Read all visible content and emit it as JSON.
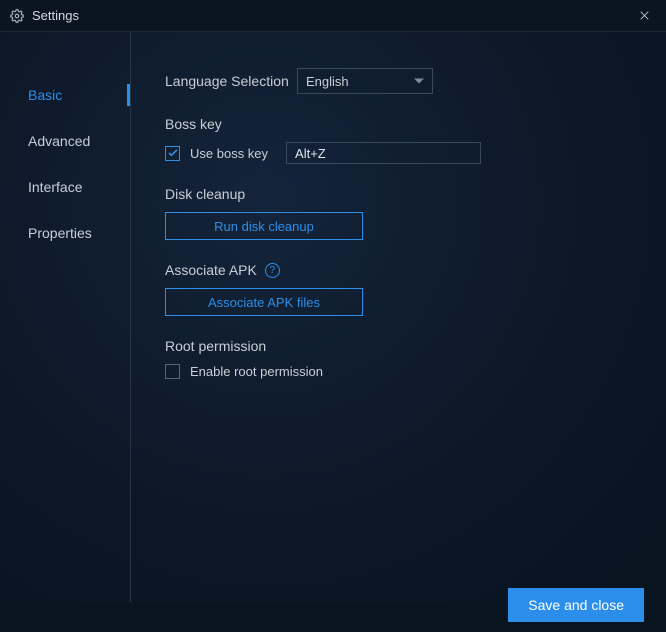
{
  "window": {
    "title": "Settings"
  },
  "sidebar": {
    "tabs": [
      {
        "label": "Basic",
        "active": true
      },
      {
        "label": "Advanced",
        "active": false
      },
      {
        "label": "Interface",
        "active": false
      },
      {
        "label": "Properties",
        "active": false
      }
    ]
  },
  "main": {
    "language": {
      "label": "Language Selection",
      "value": "English"
    },
    "bosskey": {
      "title": "Boss key",
      "checkbox_label": "Use boss key",
      "checked": true,
      "hotkey": "Alt+Z"
    },
    "cleanup": {
      "title": "Disk cleanup",
      "button": "Run disk cleanup"
    },
    "associate": {
      "title": "Associate APK",
      "help": "?",
      "button": "Associate APK files"
    },
    "root": {
      "title": "Root permission",
      "checkbox_label": "Enable root permission",
      "checked": false
    }
  },
  "footer": {
    "save": "Save and close"
  }
}
